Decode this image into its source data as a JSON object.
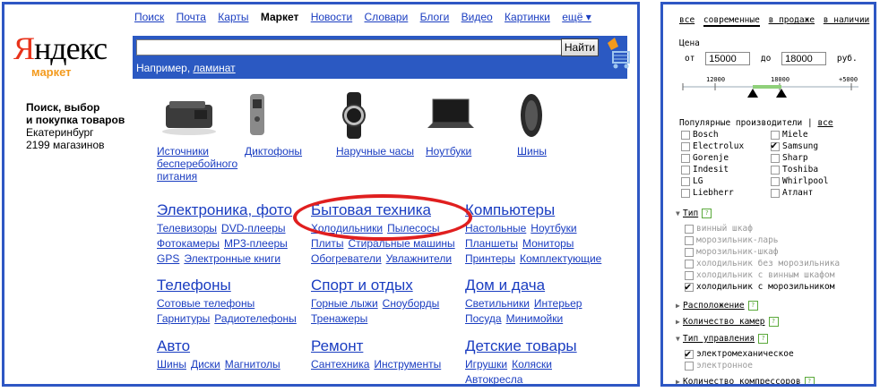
{
  "topnav": {
    "items": [
      "Поиск",
      "Почта",
      "Карты",
      "Маркет",
      "Новости",
      "Словари",
      "Блоги",
      "Видео",
      "Картинки",
      "ещё ▾"
    ]
  },
  "logo": {
    "first": "Я",
    "rest": "ндекс",
    "sub": "маркет"
  },
  "search": {
    "button": "Найти",
    "hint_prefix": "Например,",
    "hint_link": "ламинат"
  },
  "tagline": {
    "line1": "Поиск, выбор",
    "line2": "и покупка товаров",
    "city": "Екатеринбург",
    "shops": "2199 магазинов"
  },
  "products": [
    {
      "l1": "Источники",
      "l2": "бесперебойного",
      "l3": "питания"
    },
    {
      "l1": "Диктофоны"
    },
    {
      "l1": "Наручные часы"
    },
    {
      "l1": "Ноутбуки"
    },
    {
      "l1": "Шины"
    }
  ],
  "categories": {
    "elec": {
      "title": "Электроника, фото",
      "r1": [
        "Телевизоры",
        "DVD-плееры"
      ],
      "r2": [
        "Фотокамеры",
        "MP3-плееры"
      ],
      "r3": [
        "GPS",
        "Электронные книги"
      ]
    },
    "home": {
      "title": "Бытовая техника",
      "r1": [
        "Холодильники",
        "Пылесосы"
      ],
      "r2": [
        "Плиты",
        "Стиральные машины"
      ],
      "r3": [
        "Обогреватели",
        "Увлажнители"
      ]
    },
    "comp": {
      "title": "Компьютеры",
      "r1": [
        "Настольные",
        "Ноутбуки"
      ],
      "r2": [
        "Планшеты",
        "Мониторы"
      ],
      "r3": [
        "Принтеры",
        "Комплектующие"
      ]
    },
    "phones": {
      "title": "Телефоны",
      "r1": [
        "Сотовые телефоны"
      ],
      "r2": [
        "Гарнитуры",
        "Радиотелефоны"
      ]
    },
    "sport": {
      "title": "Спорт и отдых",
      "r1": [
        "Горные лыжи",
        "Сноуборды"
      ],
      "r2": [
        "Тренажеры"
      ]
    },
    "house": {
      "title": "Дом и дача",
      "r1": [
        "Светильники",
        "Интерьер"
      ],
      "r2": [
        "Посуда",
        "Минимойки"
      ]
    },
    "auto": {
      "title": "Авто",
      "r1": [
        "Шины",
        "Диски",
        "Магнитолы"
      ]
    },
    "repair": {
      "title": "Ремонт",
      "r1": [
        "Сантехника",
        "Инструменты"
      ]
    },
    "kids": {
      "title": "Детские товары",
      "r1": [
        "Игрушки",
        "Коляски"
      ],
      "r2": [
        "Автокресла"
      ]
    }
  },
  "filter": {
    "tabs": [
      "все",
      "современные",
      "в продаже",
      "в наличии"
    ],
    "price_label": "Цена",
    "from_label": "от",
    "from_value": "15000",
    "to_label": "до",
    "to_value": "18000",
    "currency": "руб.",
    "scale": [
      "12000",
      "18000",
      "+5000"
    ],
    "brands_label": "Популярные производители",
    "brands_all": "все",
    "brands_left": [
      "Bosch",
      "Electrolux",
      "Gorenje",
      "Indesit",
      "LG",
      "Liebherr"
    ],
    "brands_right": [
      "Miele",
      "Samsung",
      "Sharp",
      "Toshiba",
      "Whirlpool",
      "Атлант"
    ],
    "brands_checked": "Samsung",
    "type_label": "Тип",
    "type_options": [
      "винный шкаф",
      "морозильник-ларь",
      "морозильник-шкаф",
      "холодильник без морозильника",
      "холодильник с винным шкафом",
      "холодильник с морозильником"
    ],
    "location_label": "Расположение",
    "chambers_label": "Количество камер",
    "control_label": "Тип управления",
    "control_options": [
      "электромеханическое",
      "электронное"
    ],
    "compressors_label": "Количество компрессоров",
    "help": "?"
  },
  "colors": {
    "accent_blue": "#2b59c2",
    "link": "#1a3dc1",
    "logo_red": "#e8331b",
    "market_orange": "#f39a1d",
    "highlight_red": "#e01f1f",
    "slider_green": "#8fd07a"
  }
}
